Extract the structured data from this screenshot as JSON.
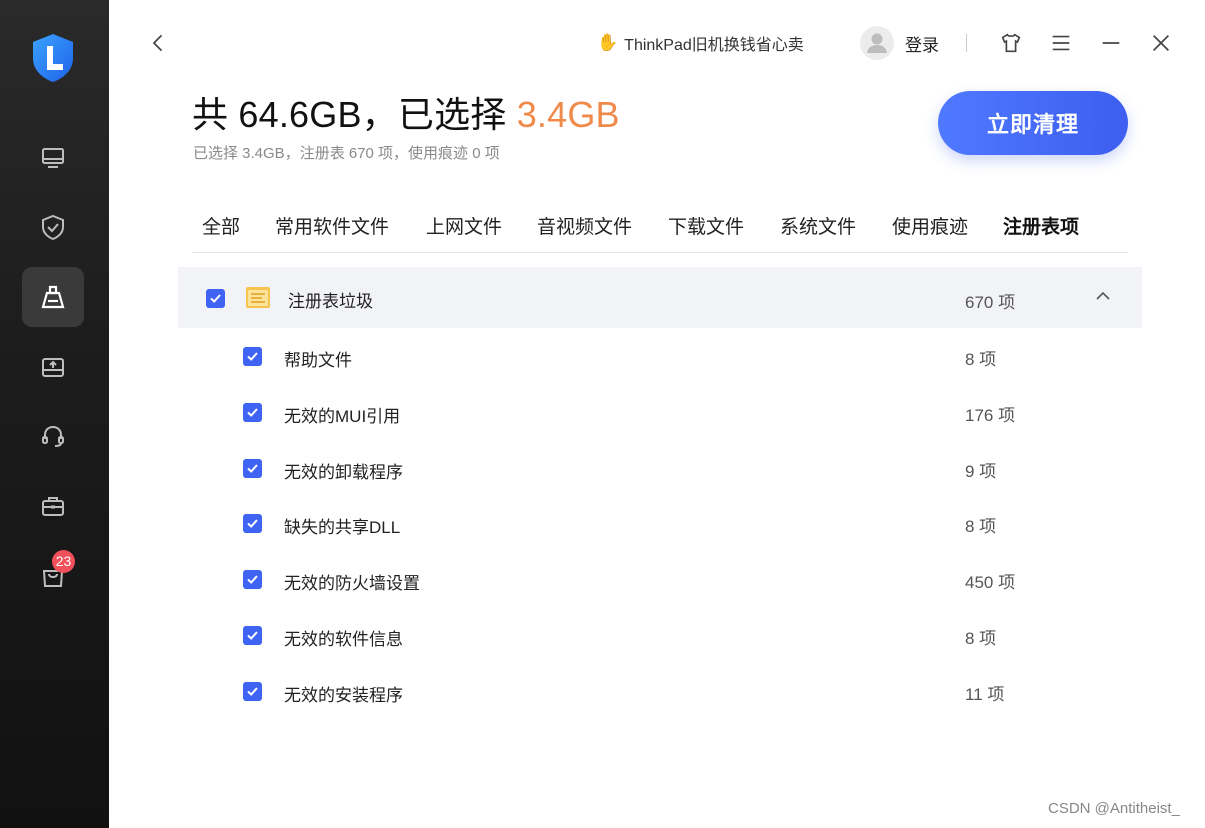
{
  "sidebar": {
    "badge_count": "23",
    "items": [
      {
        "name": "monitor-icon",
        "active": false
      },
      {
        "name": "shield-check-icon",
        "active": false
      },
      {
        "name": "broom-icon",
        "active": true
      },
      {
        "name": "disk-upload-icon",
        "active": false
      },
      {
        "name": "headset-icon",
        "active": false
      },
      {
        "name": "toolbox-icon",
        "active": false
      },
      {
        "name": "shopping-bag-icon",
        "active": false
      }
    ]
  },
  "topbar": {
    "promo_text": "ThinkPad旧机换钱省心卖",
    "login_label": "登录"
  },
  "header": {
    "prefix": "共 64.6GB，已选择 ",
    "selected_size": "3.4GB",
    "subtitle": "已选择 3.4GB，注册表 670 项，使用痕迹 0 项",
    "clean_button": "立即清理"
  },
  "tabs": [
    {
      "label": "全部",
      "active": false
    },
    {
      "label": "常用软件文件",
      "active": false
    },
    {
      "label": "上网文件",
      "active": false
    },
    {
      "label": "音视频文件",
      "active": false
    },
    {
      "label": "下载文件",
      "active": false
    },
    {
      "label": "系统文件",
      "active": false
    },
    {
      "label": "使用痕迹",
      "active": false
    },
    {
      "label": "注册表项",
      "active": true
    }
  ],
  "group": {
    "label": "注册表垃圾",
    "count": "670 项",
    "checked": true,
    "expanded": true,
    "items": [
      {
        "label": "帮助文件",
        "count": "8 项",
        "checked": true
      },
      {
        "label": "无效的MUI引用",
        "count": "176 项",
        "checked": true
      },
      {
        "label": "无效的卸载程序",
        "count": "9 项",
        "checked": true
      },
      {
        "label": "缺失的共享DLL",
        "count": "8 项",
        "checked": true
      },
      {
        "label": "无效的防火墙设置",
        "count": "450 项",
        "checked": true
      },
      {
        "label": "无效的软件信息",
        "count": "8 项",
        "checked": true
      },
      {
        "label": "无效的安装程序",
        "count": "11 项",
        "checked": true
      }
    ]
  },
  "watermark": "CSDN @Antitheist_",
  "colors": {
    "accent_blue": "#3f63f3",
    "accent_orange": "#f08a4b",
    "badge_red": "#f0505a"
  }
}
